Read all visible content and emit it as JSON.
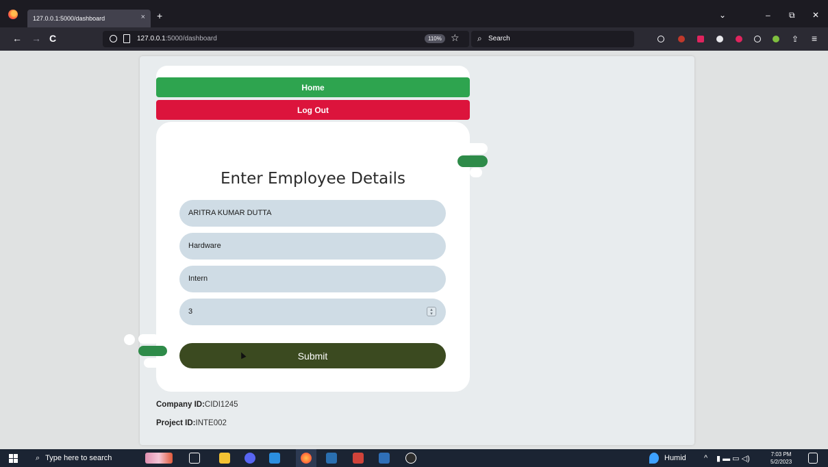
{
  "browser": {
    "tab_title": "127.0.0.1:5000/dashboard",
    "tab_close": "×",
    "new_tab": "+",
    "url_host": "127.0.0.1",
    "url_path": ":5000/dashboard",
    "zoom": "110%",
    "search_placeholder": "Search",
    "nav_back": "←",
    "nav_forward": "→",
    "nav_reload": "C",
    "win_minimize": "–",
    "win_restore": "⧉",
    "win_close": "✕",
    "tab_list": "⌄",
    "menu": "≡"
  },
  "nav": {
    "home_label": "Home",
    "logout_label": "Log Out"
  },
  "form": {
    "title": "Enter Employee Details",
    "name_value": "ARITRA KUMAR DUTTA",
    "department_value": "Hardware",
    "role_value": "Intern",
    "number_value": "3",
    "submit_label": "Submit"
  },
  "info": {
    "company_label": "Company ID:",
    "company_value": "CIDI1245",
    "project_label": "Project ID:",
    "project_value": "INTE002"
  },
  "taskbar": {
    "search_placeholder": "Type here to search",
    "weather": "Humid",
    "time": "7:03 PM",
    "date": "5/2/2023"
  },
  "colors": {
    "home": "#2ea44f",
    "logout": "#dc143c",
    "submit": "#3b4a20",
    "field": "#cfdce5"
  }
}
